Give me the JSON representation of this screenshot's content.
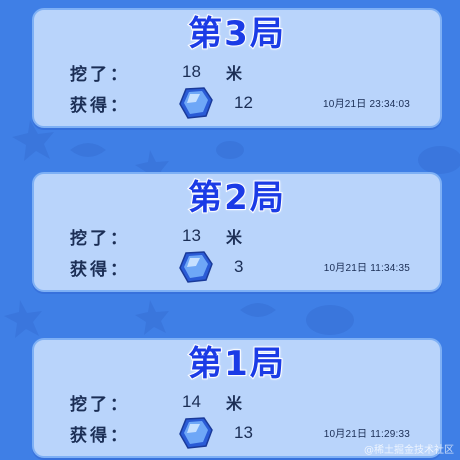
{
  "rounds": [
    {
      "title": "第3局",
      "dug_label": "挖了：",
      "dug_value": "18",
      "dug_unit": "米",
      "got_label": "获得：",
      "got_value": "12",
      "timestamp": "10月21日  23:34:03"
    },
    {
      "title": "第2局",
      "dug_label": "挖了：",
      "dug_value": "13",
      "dug_unit": "米",
      "got_label": "获得：",
      "got_value": "3",
      "timestamp": "10月21日  11:34:35"
    },
    {
      "title": "第1局",
      "dug_label": "挖了：",
      "dug_value": "14",
      "dug_unit": "米",
      "got_label": "获得：",
      "got_value": "13",
      "timestamp": "10月21日  11:29:33"
    }
  ],
  "reward_icon": "blue-gem-icon",
  "watermark": "@稀土掘金技术社区",
  "colors": {
    "background": "#3f7fe6",
    "card": "#b9d4fb",
    "title": "#1b3be6",
    "text": "#1b2e55"
  }
}
